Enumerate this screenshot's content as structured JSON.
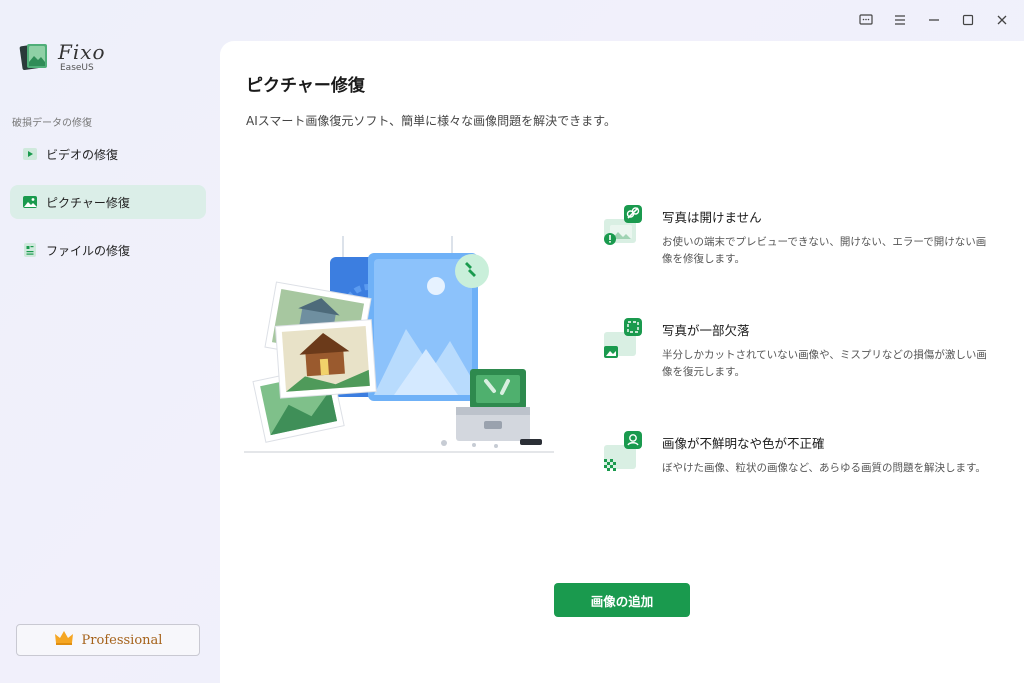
{
  "app": {
    "name": "Fixo",
    "vendor": "EaseUS"
  },
  "titlebar": {
    "icons": [
      "feedback-icon",
      "menu-icon",
      "minimize-icon",
      "maximize-icon",
      "close-icon"
    ]
  },
  "sidebar": {
    "section_label": "破損データの修復",
    "items": [
      {
        "label": "ビデオの修復",
        "icon": "video-icon",
        "active": false
      },
      {
        "label": "ピクチャー修復",
        "icon": "picture-icon",
        "active": true
      },
      {
        "label": "ファイルの修復",
        "icon": "file-icon",
        "active": false
      }
    ],
    "pro_label": "Professional"
  },
  "main": {
    "title": "ピクチャー修復",
    "subtitle": "AIスマート画像復元ソフト、簡単に様々な画像問題を解決できます。",
    "features": [
      {
        "title": "写真は開けません",
        "desc": "お使いの端末でプレビューできない、開けない、エラーで開けない画像を修復します。",
        "icon": "broken-link-icon"
      },
      {
        "title": "写真が一部欠落",
        "desc": "半分しかカットされていない画像や、ミスプリなどの損傷が激しい画像を復元します。",
        "icon": "crop-icon"
      },
      {
        "title": "画像が不鮮明なや色が不正確",
        "desc": "ぼやけた画像、粒状の画像など、あらゆる画質の問題を解決します。",
        "icon": "palette-icon"
      }
    ],
    "add_button": "画像の追加"
  },
  "colors": {
    "accent": "#1a9a4e",
    "active_nav_bg": "#dbeee8",
    "pro_text": "#a5621a"
  }
}
